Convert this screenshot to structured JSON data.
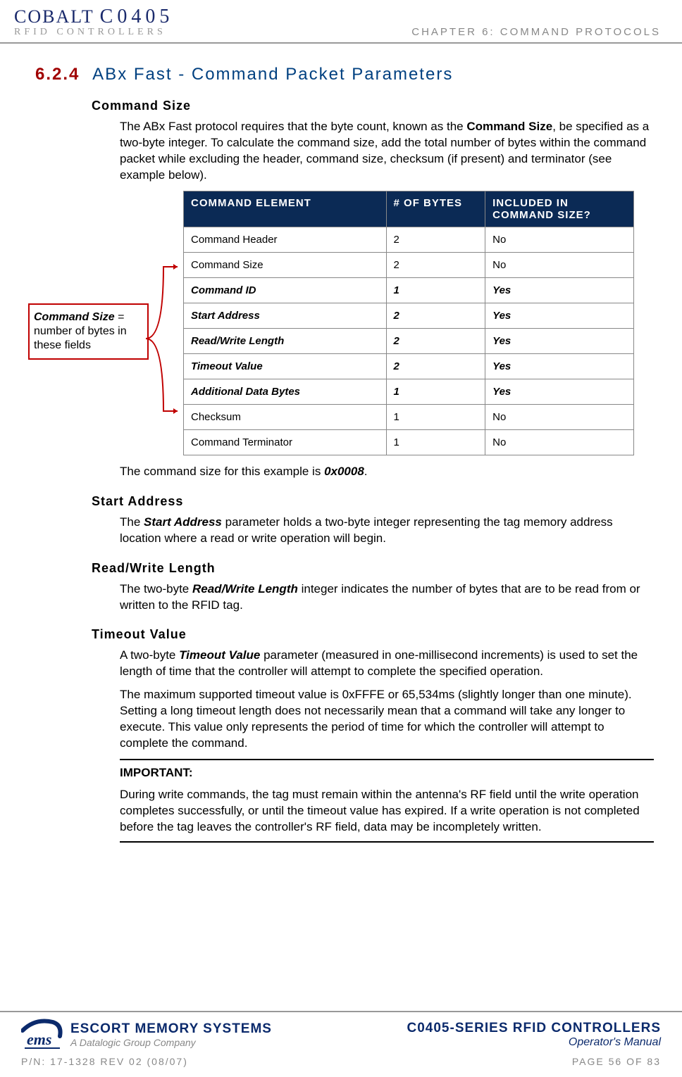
{
  "header": {
    "logo_brand": "COBALT",
    "logo_model": "C0405",
    "logo_sub": "RFID CONTROLLERS",
    "chapter": "CHAPTER 6: COMMAND PROTOCOLS"
  },
  "section": {
    "number": "6.2.4",
    "title": "ABx Fast - Command Packet Parameters"
  },
  "command_size": {
    "heading": "Command Size",
    "p1_a": "The ABx Fast protocol requires that the byte count, known as the ",
    "p1_bold": "Command Size",
    "p1_b": ", be specified as a two-byte integer. To calculate the command size, add the total number of bytes within the command packet while excluding the header, command size, checksum (if present) and terminator (see example below).",
    "p2_a": "The command size for this example is ",
    "p2_bold": "0x0008",
    "p2_b": "."
  },
  "callout": {
    "bold": "Command Size",
    "rest": " = number of bytes in these fields"
  },
  "table": {
    "headers": {
      "c1": "COMMAND ELEMENT",
      "c2": "# OF BYTES",
      "c3": "INCLUDED IN COMMAND SIZE?"
    },
    "rows": [
      {
        "el": "Command Header",
        "bytes": "2",
        "inc": "No",
        "hl": false
      },
      {
        "el": "Command Size",
        "bytes": "2",
        "inc": "No",
        "hl": false
      },
      {
        "el": "Command ID",
        "bytes": "1",
        "inc": "Yes",
        "hl": true
      },
      {
        "el": "Start Address",
        "bytes": "2",
        "inc": "Yes",
        "hl": true
      },
      {
        "el": "Read/Write Length",
        "bytes": "2",
        "inc": "Yes",
        "hl": true
      },
      {
        "el": "Timeout Value",
        "bytes": "2",
        "inc": "Yes",
        "hl": true
      },
      {
        "el": "Additional Data Bytes",
        "bytes": "1",
        "inc": "Yes",
        "hl": true
      },
      {
        "el": "Checksum",
        "bytes": "1",
        "inc": "No",
        "hl": false
      },
      {
        "el": "Command Terminator",
        "bytes": "1",
        "inc": "No",
        "hl": false
      }
    ]
  },
  "start_address": {
    "heading": "Start Address",
    "p_a": "The ",
    "p_bold": "Start Address",
    "p_b": " parameter holds a two-byte integer representing the tag memory address location where a read or write operation will begin."
  },
  "rw_length": {
    "heading": "Read/Write Length",
    "p_a": "The two-byte ",
    "p_bold": "Read/Write Length",
    "p_b": " integer indicates the number of bytes that are to be read from or written to the RFID tag."
  },
  "timeout": {
    "heading": "Timeout Value",
    "p1_a": "A two-byte ",
    "p1_bold": "Timeout Value",
    "p1_b": " parameter (measured in one-millisecond increments) is used to set the length of time that the controller will attempt to complete the specified operation.",
    "p2": "The maximum supported timeout value is 0xFFFE or 65,534ms (slightly longer than one minute). Setting a long timeout length does not necessarily mean that a command will take any longer to execute. This value only represents the period of time for which the controller will attempt to complete the command."
  },
  "important": {
    "title": "IMPORTANT:",
    "body": "During write commands, the tag must remain within the antenna's RF field until the write operation completes successfully, or until the timeout value has expired. If a write operation is not completed before the tag leaves the controller's RF field, data may be incompletely written."
  },
  "footer": {
    "ems_main": "ESCORT MEMORY SYSTEMS",
    "ems_sub": "A Datalogic Group Company",
    "right_main": "C0405-SERIES RFID CONTROLLERS",
    "right_sub": "Operator's Manual",
    "pn": "P/N: 17-1328 REV 02 (08/07)",
    "page": "PAGE 56 OF 83"
  }
}
